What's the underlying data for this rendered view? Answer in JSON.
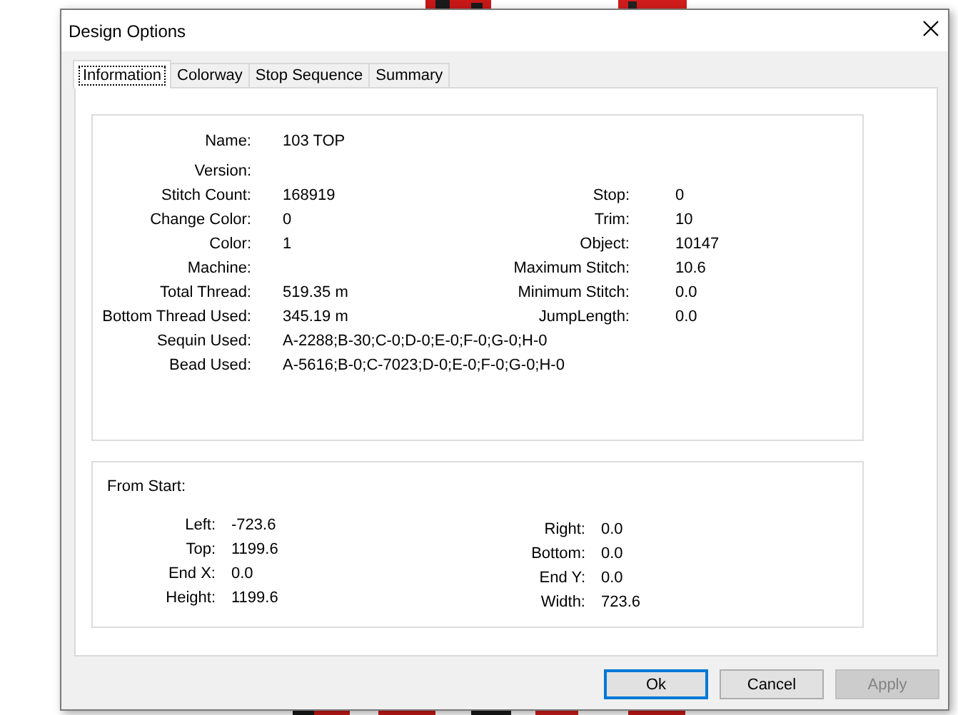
{
  "window": {
    "title": "Design Options"
  },
  "tabs": [
    {
      "label": "Information",
      "selected": true
    },
    {
      "label": "Colorway",
      "selected": false
    },
    {
      "label": "Stop Sequence",
      "selected": false
    },
    {
      "label": "Summary",
      "selected": false
    }
  ],
  "information": {
    "fields_left": [
      {
        "label": "Name:",
        "value": "103 TOP"
      },
      {
        "label": "Version:"
      },
      {
        "label": "Stitch Count:",
        "value": "168919"
      },
      {
        "label": "Change Color:",
        "value": "0"
      },
      {
        "label": "Color:",
        "value": "1"
      },
      {
        "label": "Machine:"
      },
      {
        "label": "Total Thread:",
        "value": "519.35 m"
      },
      {
        "label": "Bottom Thread Used:",
        "value": "345.19 m"
      },
      {
        "label": "Sequin Used:",
        "value": "A-2288;B-30;C-0;D-0;E-0;F-0;G-0;H-0"
      },
      {
        "label": "Bead Used:",
        "value": "A-5616;B-0;C-7023;D-0;E-0;F-0;G-0;H-0"
      }
    ],
    "fields_right": [
      {
        "label": "Stop:",
        "value": "0"
      },
      {
        "label": "Trim:",
        "value": "10"
      },
      {
        "label": "Object:",
        "value": "10147"
      },
      {
        "label": "Maximum Stitch:",
        "value": "10.6"
      },
      {
        "label": "Minimum Stitch:",
        "value": "0.0"
      },
      {
        "label": "JumpLength:",
        "value": "0.0"
      }
    ]
  },
  "from_start": {
    "title": "From Start:",
    "fields_left": [
      {
        "label": "Left:",
        "value": "-723.6"
      },
      {
        "label": "Top:",
        "value": "1199.6"
      },
      {
        "label": "End X:",
        "value": "0.0"
      },
      {
        "label": "Height:",
        "value": "1199.6"
      }
    ],
    "fields_right": [
      {
        "label": "Right:",
        "value": "0.0"
      },
      {
        "label": "Bottom:",
        "value": "0.0"
      },
      {
        "label": "End Y:",
        "value": "0.0"
      },
      {
        "label": "Width:",
        "value": "723.6"
      }
    ]
  },
  "buttons": [
    {
      "label": "Ok",
      "default": true,
      "disabled": false
    },
    {
      "label": "Cancel",
      "default": false,
      "disabled": false
    },
    {
      "label": "Apply",
      "default": false,
      "disabled": true
    }
  ]
}
